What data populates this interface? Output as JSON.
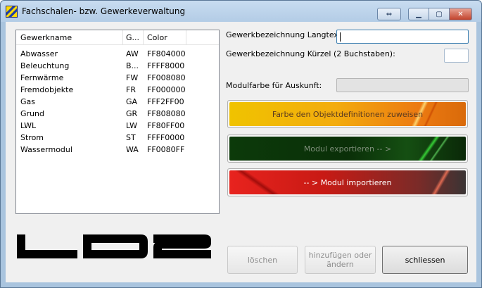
{
  "window": {
    "title": "Fachschalen- bzw. Gewerkeverwaltung",
    "close_glyph": "✕",
    "min_glyph": "▁",
    "max_glyph": "▢",
    "sync_glyph": "⇔"
  },
  "list": {
    "columns": [
      "Gewerkname",
      "G...",
      "Color"
    ],
    "rows": [
      {
        "name": "Abwasser",
        "code": "AW",
        "color": "FF804000"
      },
      {
        "name": "Beleuchtung",
        "code": "B...",
        "color": "FFFF8000"
      },
      {
        "name": "Fernwärme",
        "code": "FW",
        "color": "FF008080"
      },
      {
        "name": "Fremdobjekte",
        "code": "FR",
        "color": "FF000000"
      },
      {
        "name": "Gas",
        "code": "GA",
        "color": "FFF2FF00"
      },
      {
        "name": "Grund",
        "code": "GR",
        "color": "FF808080"
      },
      {
        "name": "LWL",
        "code": "LW",
        "color": "FF80FF00"
      },
      {
        "name": "Strom",
        "code": "ST",
        "color": "FFFF0000"
      },
      {
        "name": "Wassermodul",
        "code": "WA",
        "color": "FF0080FF"
      }
    ]
  },
  "form": {
    "longtext_label": "Gewerkbezeichnung Langtext:",
    "longtext_value": "",
    "short_label": "Gewerkbezeichnung Kürzel (2 Buchstaben):",
    "short_value": "",
    "color_label": "Modulfarbe für Auskunft:"
  },
  "action_buttons": {
    "assign_color": "Farbe den Objektdefinitionen zuweisen",
    "export": "Modul exportieren -- >",
    "import": "-- > Modul importieren"
  },
  "bottom_buttons": {
    "delete": "löschen",
    "add_change": "hinzufügen oder\nändern",
    "close": "schliessen"
  },
  "colors": {
    "accent_orange": "#f3ac0e",
    "accent_green": "#0a2f08",
    "accent_red": "#e8231e",
    "titlebar": "#b9d1ea"
  }
}
